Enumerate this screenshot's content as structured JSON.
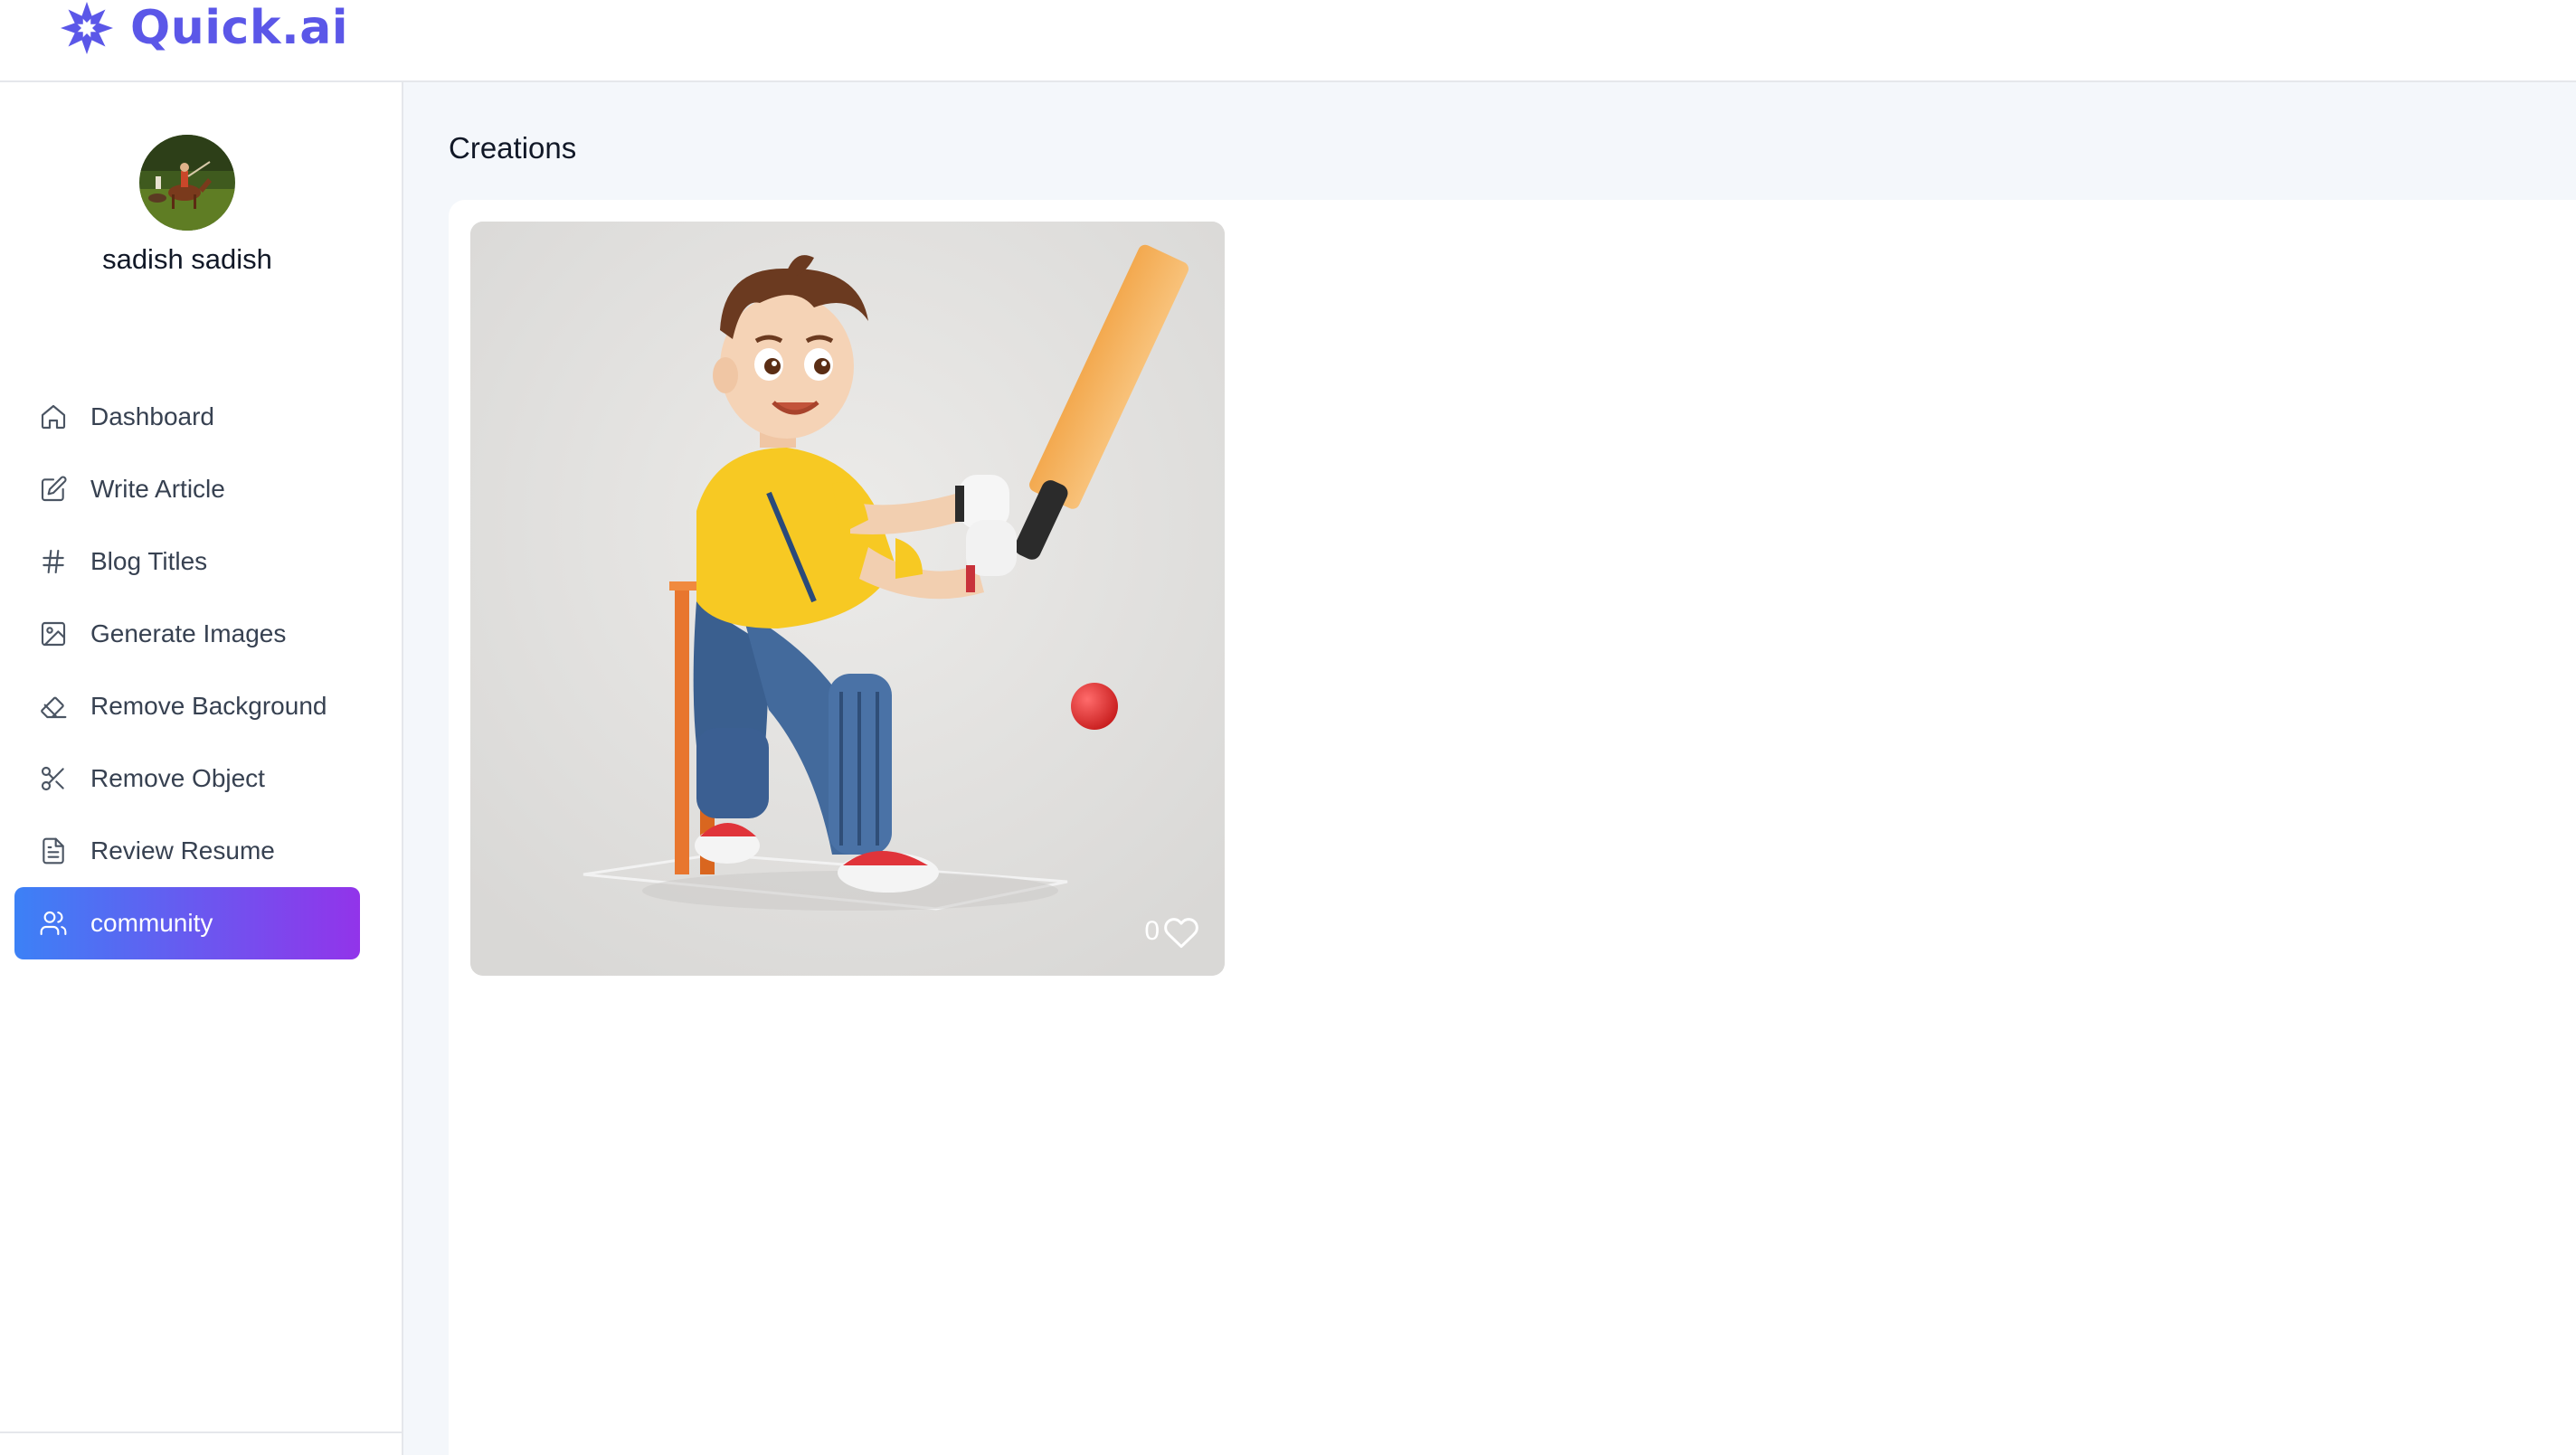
{
  "app": {
    "name": "Quick.ai"
  },
  "user": {
    "name": "sadish sadish"
  },
  "sidebar": {
    "items": [
      {
        "label": "Dashboard",
        "icon": "home-icon",
        "active": false
      },
      {
        "label": "Write Article",
        "icon": "edit-icon",
        "active": false
      },
      {
        "label": "Blog Titles",
        "icon": "hash-icon",
        "active": false
      },
      {
        "label": "Generate Images",
        "icon": "image-icon",
        "active": false
      },
      {
        "label": "Remove Background",
        "icon": "eraser-icon",
        "active": false
      },
      {
        "label": "Remove Object",
        "icon": "scissors-icon",
        "active": false
      },
      {
        "label": "Review Resume",
        "icon": "file-text-icon",
        "active": false
      },
      {
        "label": "community",
        "icon": "users-icon",
        "active": true
      }
    ]
  },
  "main": {
    "title": "Creations",
    "creations": [
      {
        "likes": "0",
        "image": "cartoon-cricket-batsman"
      }
    ]
  },
  "colors": {
    "brand": "#5b57e8",
    "active_gradient_start": "#3c81f6",
    "active_gradient_end": "#9234ea",
    "main_background": "#f4f7fb"
  }
}
